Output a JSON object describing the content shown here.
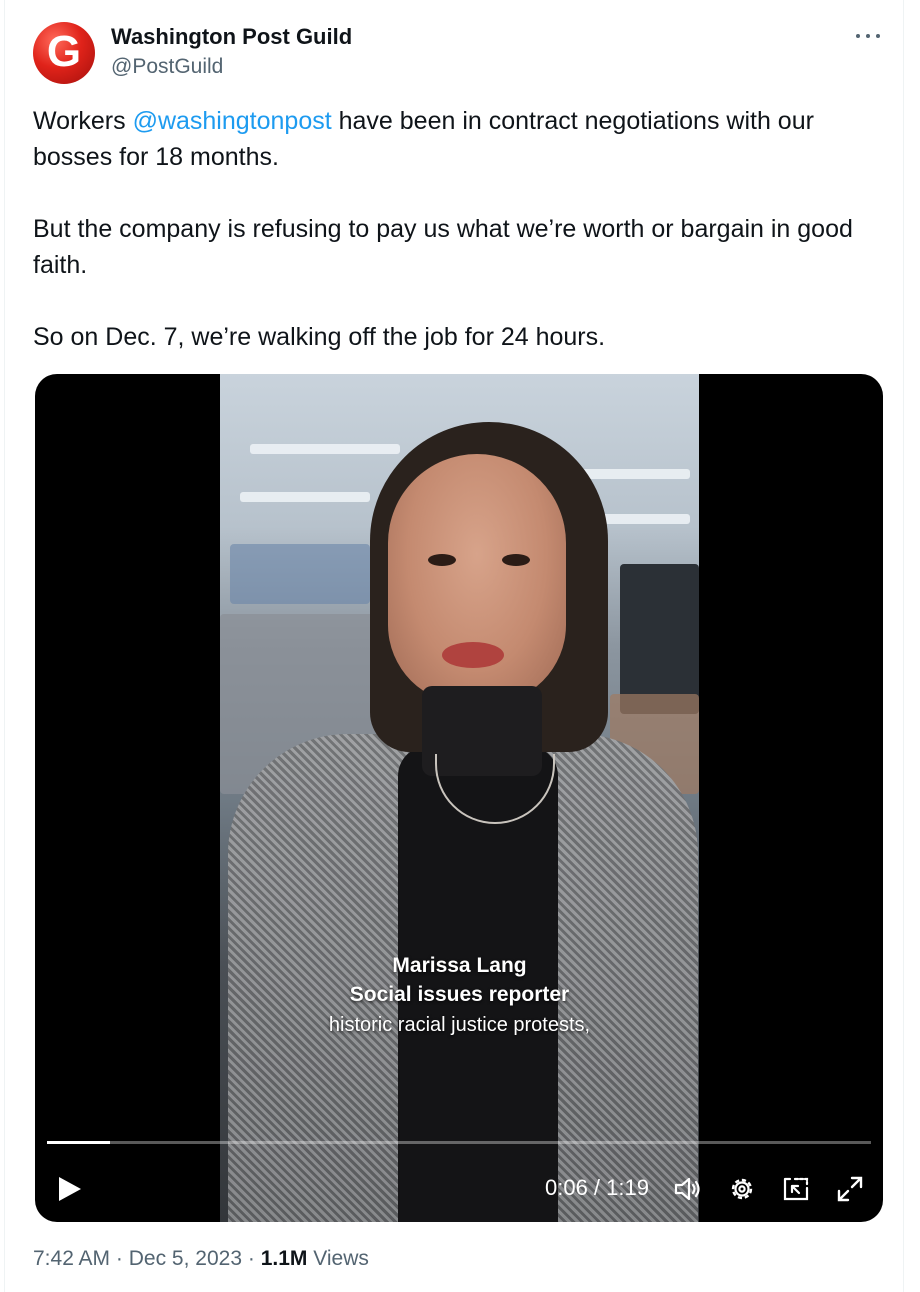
{
  "author": {
    "avatar_letter": "G",
    "name": "Washington Post Guild",
    "handle": "@PostGuild"
  },
  "tweet": {
    "paragraphs": [
      {
        "before": "Workers ",
        "mention": "@washingtonpost",
        "after": " have been in contract negotiations with our bosses for 18 months."
      },
      {
        "text": "But the company is refusing to pay us what we’re worth or bargain in good faith."
      },
      {
        "text": "So on Dec. 7, we’re walking off the job for 24 hours."
      }
    ]
  },
  "video": {
    "caption_name": "Marissa Lang",
    "caption_title": "Social issues reporter",
    "caption_subtitle": "historic racial justice protests,",
    "time_readout": "0:06 / 1:19",
    "progress_fraction": 0.076,
    "controls": [
      "play-icon",
      "volume-icon",
      "settings-icon",
      "picture-in-picture-icon",
      "fullscreen-icon"
    ]
  },
  "meta": {
    "time": "7:42 AM",
    "separator": "·",
    "date": "Dec 5, 2023",
    "views_count": "1.1M",
    "views_label": "Views"
  },
  "colors": {
    "accent": "#1d9bf0",
    "text": "#0f1419",
    "secondary": "#536471",
    "avatar_red": "#e0231a"
  }
}
